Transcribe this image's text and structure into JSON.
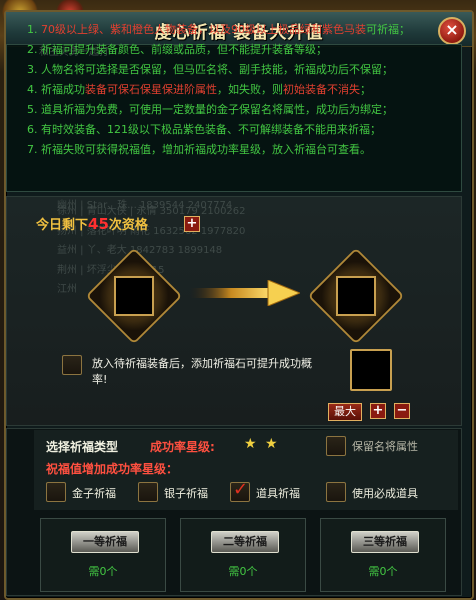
{
  "window": {
    "title": "虔心祈福  装备大升值",
    "close_icon": "close-icon"
  },
  "rules": [
    {
      "num": "1.",
      "parts": [
        {
          "c": "r",
          "t": "70级以上绿、紫和橙色人物装备，以及90级以上极品绿和紫色马装"
        },
        {
          "c": "g",
          "t": "可祈福；"
        }
      ]
    },
    {
      "num": "2.",
      "parts": [
        {
          "c": "g",
          "t": "祈福可提升装备颜色、前缀或品质，但不能提升装备等级；"
        }
      ]
    },
    {
      "num": "3.",
      "parts": [
        {
          "c": "g",
          "t": "人物名将可选择是否保留，但马匹名将、副手技能，祈福成功后不保留；"
        }
      ]
    },
    {
      "num": "4.",
      "parts": [
        {
          "c": "g",
          "t": "祈福成功"
        },
        {
          "c": "r",
          "t": "装备可保石保星保进阶属性"
        },
        {
          "c": "g",
          "t": "，如失败，则"
        },
        {
          "c": "r",
          "t": "初始装备不消失"
        },
        {
          "c": "g",
          "t": "；"
        }
      ]
    },
    {
      "num": "5.",
      "parts": [
        {
          "c": "g",
          "t": "道具祈福为免费，可使用一定数量的金子保留名将属性，成功后为绑定；"
        }
      ]
    },
    {
      "num": "6.",
      "parts": [
        {
          "c": "g",
          "t": "有时效装备、121级以下极品紫色装备、不可解绑装备不能用来祈福；"
        }
      ]
    },
    {
      "num": "7.",
      "parts": [
        {
          "c": "g",
          "t": "祈福失败可获得祝福值，增加祈福成功率星级，放入祈福台可查看。"
        }
      ]
    }
  ],
  "remaining": {
    "prefix": "今日剩下",
    "count": "45",
    "suffix": "次资格"
  },
  "put_hint": "放入待祈福装备后，添加祈福石可提升成功概",
  "put_hint2": "率!",
  "stone_controls": {
    "max_label": "最大",
    "plus_label": "+",
    "minus_label": "−"
  },
  "select_type_label": "选择祈福类型",
  "success_star_label": "成功率星级:",
  "success_stars": "★ ★",
  "keep_general_label": "保留名将属性",
  "blessing_label": "祝福值增加成功率星级：",
  "options": [
    {
      "label": "金子祈福",
      "checked": false
    },
    {
      "label": "银子祈福",
      "checked": false
    },
    {
      "label": "道具祈福",
      "checked": true
    },
    {
      "label": "使用必成道具",
      "checked": false
    }
  ],
  "grades": [
    {
      "label": "一等祈福",
      "need": "需0个"
    },
    {
      "label": "二等祈福",
      "need": "需0个"
    },
    {
      "label": "三等祈福",
      "need": "需0个"
    }
  ],
  "background_ghost": [
    {
      "t": "徐州          | 青山大侠 | 永情               350179               2100262"
    },
    {
      "t": "扬州          | 落花叶明       雨花       1632562              1977820"
    },
    {
      "t": "益州          | 丫、老大                  1842783              1899148"
    },
    {
      "t": "荆州          | 坏浮尘                    1351315"
    },
    {
      "t": "江州"
    },
    {
      "t": "幽州          | Star、珠...              1839544              2407774"
    },
    {
      "t": "和主贝勇一起打"
    }
  ]
}
